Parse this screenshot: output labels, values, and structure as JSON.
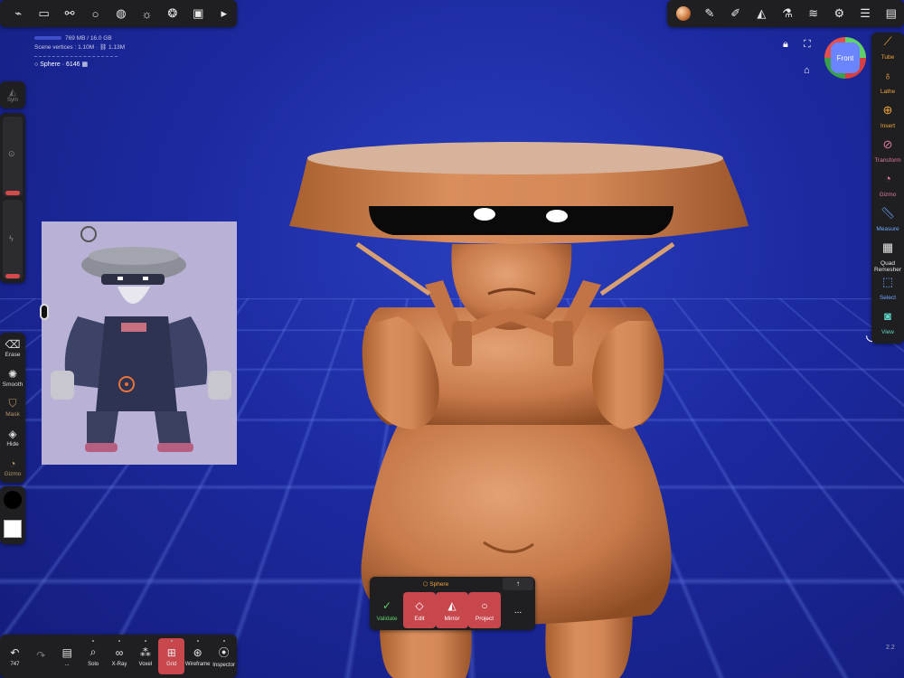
{
  "stats": {
    "memory": "769 MB / 16.0 GB",
    "vertices_label": "Scene vertices :",
    "vertices_value": "1.10M",
    "vertices_alt": "1.13M",
    "object_name": "Sphere",
    "object_count": "6146"
  },
  "left_rail": {
    "sym_label": "Sym",
    "tools": [
      {
        "label": "Erase",
        "icon": "eraser-icon"
      },
      {
        "label": "Smooth",
        "icon": "smooth-icon"
      },
      {
        "label": "Mask",
        "icon": "mask-icon"
      },
      {
        "label": "Hide",
        "icon": "hide-icon"
      },
      {
        "label": "Gizmo",
        "icon": "gizmo-icon"
      }
    ]
  },
  "right_tools": [
    {
      "label": "Tube",
      "color": "#f0a43a"
    },
    {
      "label": "Lathe",
      "color": "#f0a43a"
    },
    {
      "label": "Insert",
      "color": "#f0a43a"
    },
    {
      "label": "Transform",
      "color": "#e07aa0"
    },
    {
      "label": "Gizmo",
      "color": "#e07aa0"
    },
    {
      "label": "Measure",
      "color": "#6ea8ff"
    },
    {
      "label": "Quad Remesher",
      "color": "#e8e8e8"
    },
    {
      "label": "Select",
      "color": "#6ea8ff"
    },
    {
      "label": "View",
      "color": "#5fd6c8"
    }
  ],
  "gizmo": {
    "face_label": "Front"
  },
  "bottom_bar": {
    "undo_count": "747",
    "items": [
      {
        "label": "Solo"
      },
      {
        "label": "X-Ray"
      },
      {
        "label": "Voxel"
      },
      {
        "label": "Grid"
      },
      {
        "label": "Wireframe"
      },
      {
        "label": "Inspector"
      }
    ],
    "ellipsis": "..."
  },
  "popover": {
    "title": "Sphere",
    "buttons": [
      {
        "label": "Validate"
      },
      {
        "label": "Edit"
      },
      {
        "label": "Mirror"
      },
      {
        "label": "Project"
      }
    ],
    "more": "..."
  },
  "version": "2.2",
  "colors": {
    "accent_red": "#c8474d",
    "tool_orange": "#f0a43a",
    "background": "#1c2aa0",
    "clay": "#cf8555"
  }
}
